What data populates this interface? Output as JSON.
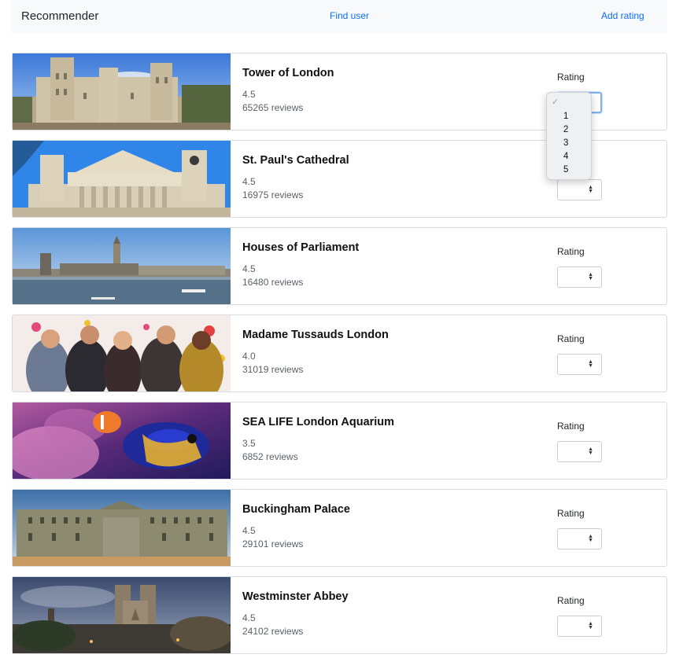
{
  "navbar": {
    "brand": "Recommender",
    "find_user": "Find user",
    "add_rating": "Add rating"
  },
  "rating_label": "Rating",
  "dropdown": {
    "check": "✓",
    "options": [
      "1",
      "2",
      "3",
      "4",
      "5"
    ]
  },
  "attractions": [
    {
      "name": "Tower of London",
      "score": "4.5",
      "reviews": "65265 reviews",
      "image": "tower-of-london"
    },
    {
      "name": "St. Paul's Cathedral",
      "score": "4.5",
      "reviews": "16975 reviews",
      "image": "st-pauls-cathedral"
    },
    {
      "name": "Houses of Parliament",
      "score": "4.5",
      "reviews": "16480 reviews",
      "image": "houses-of-parliament"
    },
    {
      "name": "Madame Tussauds London",
      "score": "4.0",
      "reviews": "31019 reviews",
      "image": "madame-tussauds"
    },
    {
      "name": "SEA LIFE London Aquarium",
      "score": "3.5",
      "reviews": "6852 reviews",
      "image": "sea-life-aquarium"
    },
    {
      "name": "Buckingham Palace",
      "score": "4.5",
      "reviews": "29101 reviews",
      "image": "buckingham-palace"
    },
    {
      "name": "Westminster Abbey",
      "score": "4.5",
      "reviews": "24102 reviews",
      "image": "westminster-abbey"
    }
  ]
}
